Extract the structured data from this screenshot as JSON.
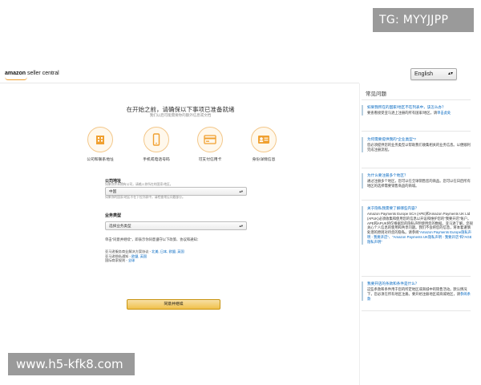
{
  "watermarks": {
    "top": "TG: MYYJJPP",
    "bottom": "www.h5-kfk8.com"
  },
  "header": {
    "logo_main": "amazon",
    "logo_sub": "seller central",
    "language": "English"
  },
  "main": {
    "title": "在开始之前，请确保以下事项已准备就绪",
    "subtitle": "我们以后可能需要你的额外信息或文档",
    "requirements": [
      {
        "icon": "building-icon",
        "label": "公司和联系地址"
      },
      {
        "icon": "mobile-phone-icon",
        "label": "手机或电话号码"
      },
      {
        "icon": "credit-card-icon",
        "label": "可支付信用卡"
      },
      {
        "icon": "id-card-icon",
        "label": "身份详情信息"
      }
    ],
    "company_address": {
      "label": "公司地址",
      "help1": "如果你并未拥有公司，请输入你所在的国家/地区。",
      "value": "中国",
      "help2": "如果你的国家/地区不在下拉列表中，请检查常见问题部分。"
    },
    "business_type": {
      "label": "业务类型",
      "value": "选择业务类型"
    },
    "agree_text": "单击\"同意并继续\"，即表示你同意遵守以下政策、协议和通知：",
    "info": {
      "line1_text": "亚马逊服务商业解决方案协议 - ",
      "line1_links": "北美, 日本, 欧盟, 英国",
      "line2_text": "亚马逊隐私通知 - ",
      "line2_links": "欧盟, 英国",
      "line3_text": "国际商家规则 - ",
      "line3_links": "全球"
    },
    "agree_button": "同意并继续"
  },
  "faq": {
    "title": "常见问题",
    "items": [
      {
        "question": "如果我所在的国家/地区不在列表中，该怎么办？",
        "answer": "要查看接受亚马逊上注册的所有国家/地区，请",
        "link": "单击此处"
      },
      {
        "question": "为何需要提供我的\"企业类型\"?",
        "answer": "您必须提供您的业务类型以帮助我们收集相关的业务信息。以便顺利完成注册流程。",
        "link": ""
      },
      {
        "question": "为什么要注册多个地区？",
        "answer": "通过注册多个地区，您可以在全球销售您的商品。您可以在日后所有地区的选择需要销售商品的商城。",
        "link": ""
      },
      {
        "question": "关于隐私我需要了解哪些内容？",
        "answer": "Amazon Payments Europe SCA (APE)和Amazon Payments UK Ltd (APUK)必须收集和使用您的信息以开设和维护您的\"我要开店\"账户。APE和APUK将仅根据您的隐私声明使用您的数据。亚马逊了解，您很关心个人信息的使用和共享问题。我们不会将您的信息，将本着谨慎处理的原则对待您的隐私。请参阅",
        "link": "\"Amazon Payments Europe隐私声明 - 我要开店\"、\"Amazon Payments UK隐私声明 - 我要开店\"和\"AGE隐私声明\""
      },
      {
        "question": "我要开店的条款和条件是什么？",
        "answer": "这些条款和条件用于您的所定地区或商城中的销售活动。默认情况下，您必须在所有地区注册。要开始注册地区或商城地区，请",
        "link": "参阅条款"
      }
    ]
  }
}
